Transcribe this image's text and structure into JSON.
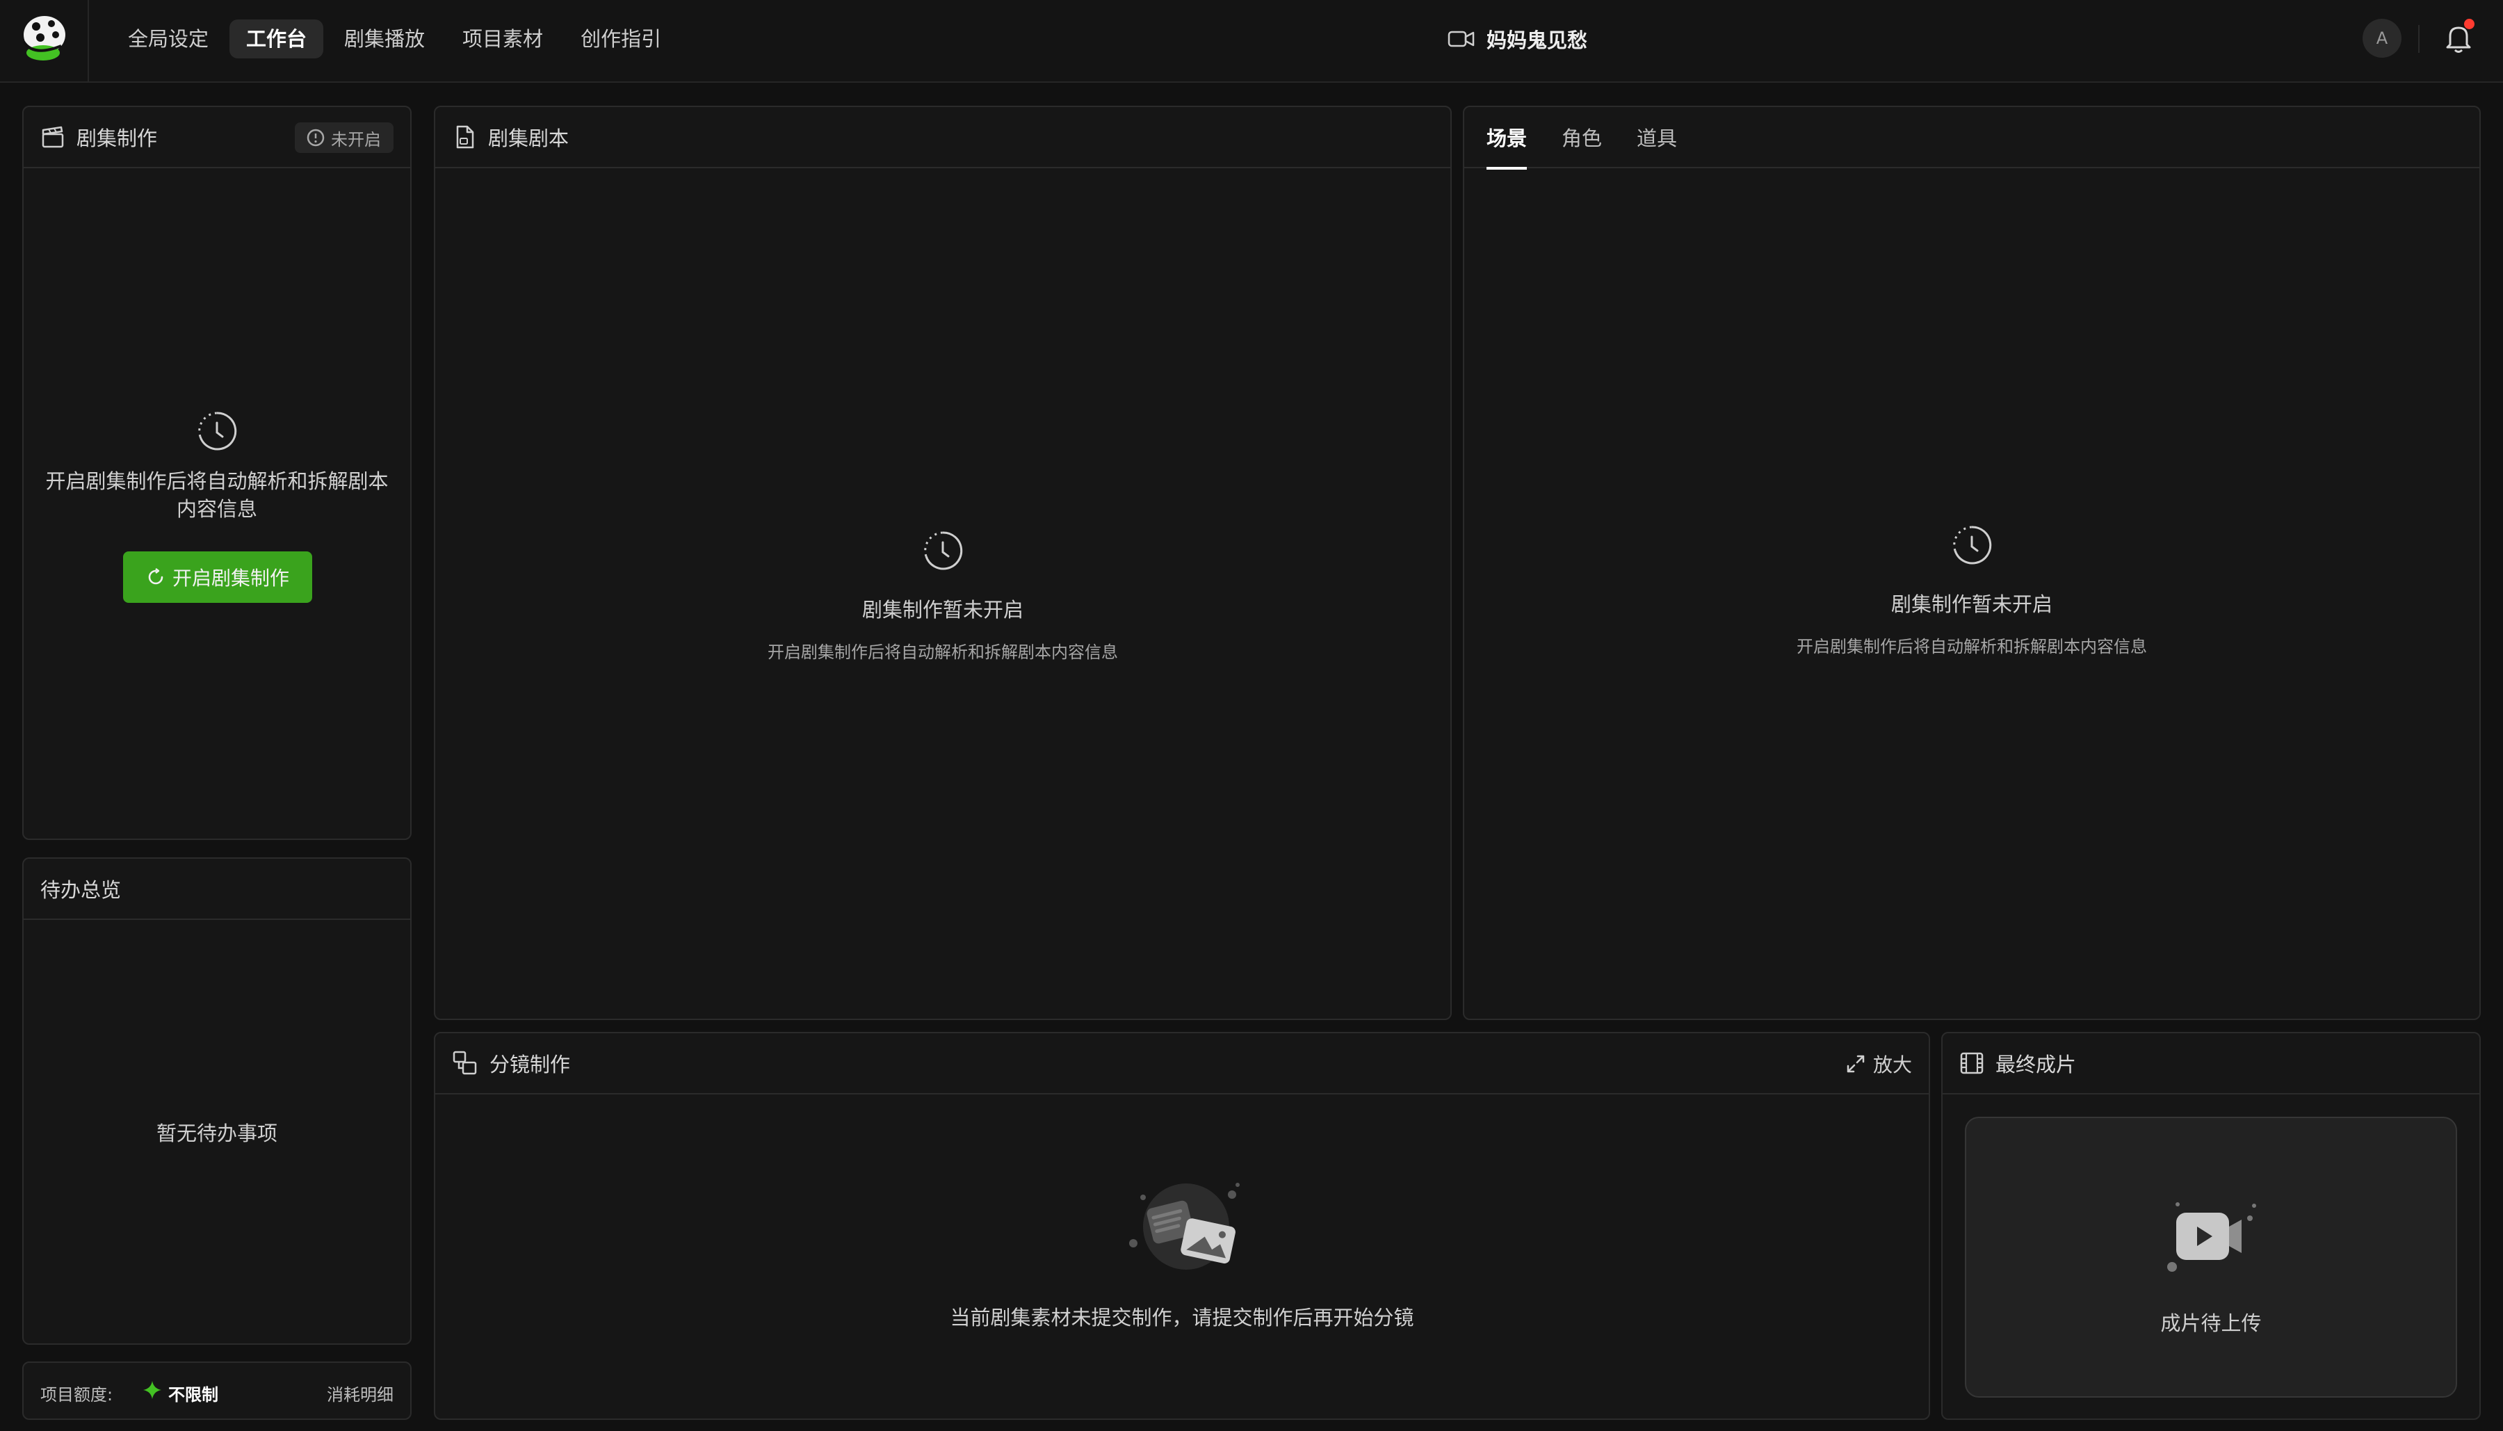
{
  "topbar": {
    "nav": [
      "全局设定",
      "工作台",
      "剧集播放",
      "项目素材",
      "创作指引"
    ],
    "project_title": "妈妈鬼见愁",
    "avatar_initial": "A"
  },
  "production": {
    "title": "剧集制作",
    "status": "未开启",
    "message": "开启剧集制作后将自动解析和拆解剧本内容信息",
    "button": "开启剧集制作"
  },
  "todo": {
    "title": "待办总览",
    "empty": "暂无待办事项"
  },
  "quota": {
    "label": "项目额度:",
    "value": "不限制",
    "detail": "消耗明细"
  },
  "script_panel": {
    "title": "剧集剧本",
    "empty_title": "剧集制作暂未开启",
    "empty_sub": "开启剧集制作后将自动解析和拆解剧本内容信息"
  },
  "assets_panel": {
    "tabs": [
      "场景",
      "角色",
      "道具"
    ],
    "active_tab": "场景",
    "empty_title": "剧集制作暂未开启",
    "empty_sub": "开启剧集制作后将自动解析和拆解剧本内容信息"
  },
  "storyboard": {
    "title": "分镜制作",
    "zoom": "放大",
    "empty": "当前剧集素材未提交制作，请提交制作后再开始分镜"
  },
  "final_cut": {
    "title": "最终成片",
    "status": "成片待上传"
  },
  "colors": {
    "accent_green": "#3aa31d",
    "notification_dot": "#ff3b30",
    "background": "#111111",
    "panel": "#161616"
  }
}
